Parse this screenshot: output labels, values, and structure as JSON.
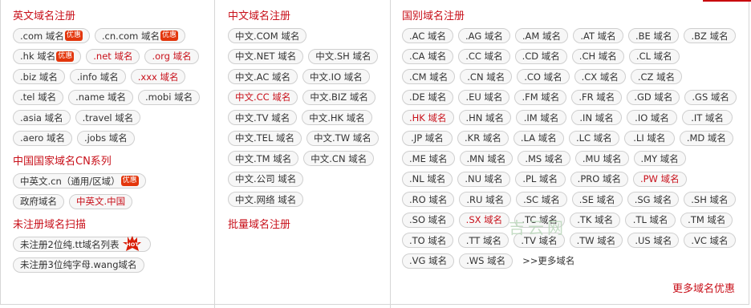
{
  "col1": {
    "title": "英文域名注册",
    "items": [
      [
        {
          "t": ".com 域名",
          "red": false,
          "badge": "优惠"
        },
        {
          "t": ".cn.com 域名",
          "red": false,
          "badge": "优惠"
        }
      ],
      [
        {
          "t": ".hk 域名",
          "red": false,
          "badge": "优惠"
        },
        {
          "t": ".net 域名",
          "red": true
        },
        {
          "t": ".org 域名",
          "red": true
        }
      ],
      [
        {
          "t": ".biz 域名",
          "red": false
        },
        {
          "t": ".info 域名",
          "red": false
        },
        {
          "t": ".xxx 域名",
          "red": true
        }
      ],
      [
        {
          "t": ".tel 域名",
          "red": false
        },
        {
          "t": ".name 域名",
          "red": false
        },
        {
          "t": ".mobi 域名",
          "red": false
        }
      ],
      [
        {
          "t": ".asia 域名",
          "red": false
        },
        {
          "t": ".travel 域名",
          "red": false
        }
      ],
      [
        {
          "t": ".aero 域名",
          "red": false
        },
        {
          "t": ".jobs 域名",
          "red": false
        }
      ]
    ],
    "sec2_title": "中国国家域名CN系列",
    "sec2_items": [
      [
        {
          "t": "中英文.cn（通用/区域）",
          "red": false,
          "badge": "优惠"
        }
      ],
      [
        {
          "t": "政府域名",
          "red": false
        },
        {
          "t": "中英文.中国",
          "red": true
        }
      ]
    ],
    "sec3_title": "未注册域名扫描",
    "sec3_items": [
      [
        {
          "t": "未注册2位纯.tt域名列表",
          "red": false,
          "hot": "HOT"
        }
      ],
      [
        {
          "t": "未注册3位纯字母.wang域名",
          "red": false
        }
      ]
    ]
  },
  "col2": {
    "title": "中文域名注册",
    "items": [
      [
        {
          "t": "中文.COM 域名",
          "red": false
        }
      ],
      [
        {
          "t": "中文.NET 域名",
          "red": false
        },
        {
          "t": "中文.SH 域名",
          "red": false
        }
      ],
      [
        {
          "t": "中文.AC 域名",
          "red": false
        },
        {
          "t": "中文.IO 域名",
          "red": false
        }
      ],
      [
        {
          "t": "中文.CC 域名",
          "red": true
        },
        {
          "t": "中文.BIZ 域名",
          "red": false
        }
      ],
      [
        {
          "t": "中文.TV 域名",
          "red": false
        },
        {
          "t": "中文.HK 域名",
          "red": false
        }
      ],
      [
        {
          "t": "中文.TEL 域名",
          "red": false
        },
        {
          "t": "中文.TW 域名",
          "red": false
        }
      ],
      [
        {
          "t": "中文.TM 域名",
          "red": false
        },
        {
          "t": "中文.CN 域名",
          "red": false
        }
      ],
      [
        {
          "t": "中文.公司 域名",
          "red": false
        }
      ],
      [
        {
          "t": "中文.网络 域名",
          "red": false
        }
      ]
    ],
    "sec2_title": "批量域名注册"
  },
  "col3": {
    "title": "国别域名注册",
    "rows": [
      [
        ".AC 域名",
        ".AG 域名",
        ".AM 域名",
        ".AT 域名",
        ".BE 域名",
        ".BZ 域名"
      ],
      [
        ".CA 域名",
        ".CC 域名",
        ".CD 域名",
        ".CH 域名",
        ".CL 域名"
      ],
      [
        ".CM 域名",
        ".CN 域名",
        ".CO 域名",
        ".CX 域名",
        ".CZ 域名"
      ],
      [
        ".DE 域名",
        ".EU 域名",
        ".FM 域名",
        ".FR 域名",
        ".GD 域名",
        ".GS 域名"
      ],
      [
        ".HK 域名",
        ".HN 域名",
        ".IM 域名",
        ".IN 域名",
        ".IO 域名",
        ".IT 域名"
      ],
      [
        ".JP 域名",
        ".KR 域名",
        ".LA 域名",
        ".LC 域名",
        ".LI 域名",
        ".MD 域名"
      ],
      [
        ".ME 域名",
        ".MN 域名",
        ".MS 域名",
        ".MU 域名",
        ".MY 域名"
      ],
      [
        ".NL 域名",
        ".NU 域名",
        ".PL 域名",
        ".PRO 域名",
        ".PW 域名"
      ],
      [
        ".RO 域名",
        ".RU 域名",
        ".SC 域名",
        ".SE 域名",
        ".SG 域名",
        ".SH 域名"
      ],
      [
        ".SO 域名",
        ".SX 域名",
        ".TC 域名",
        ".TK 域名",
        ".TL 域名",
        ".TM 域名"
      ],
      [
        ".TO 域名",
        ".TT 域名",
        ".TV 域名",
        ".TW 域名",
        ".US 域名",
        ".VC 域名"
      ],
      [
        ".VG 域名",
        ".WS 域名"
      ]
    ],
    "red": [
      ".HK 域名",
      ".PW 域名",
      ".SX 域名"
    ],
    "more_link": ">>更多域名",
    "more_promo": "更多域名优惠"
  },
  "watermark": "吉云网",
  "colors": {
    "accent": "#c8101a",
    "badge": "#e3360c",
    "border": "#cfcfcf"
  }
}
